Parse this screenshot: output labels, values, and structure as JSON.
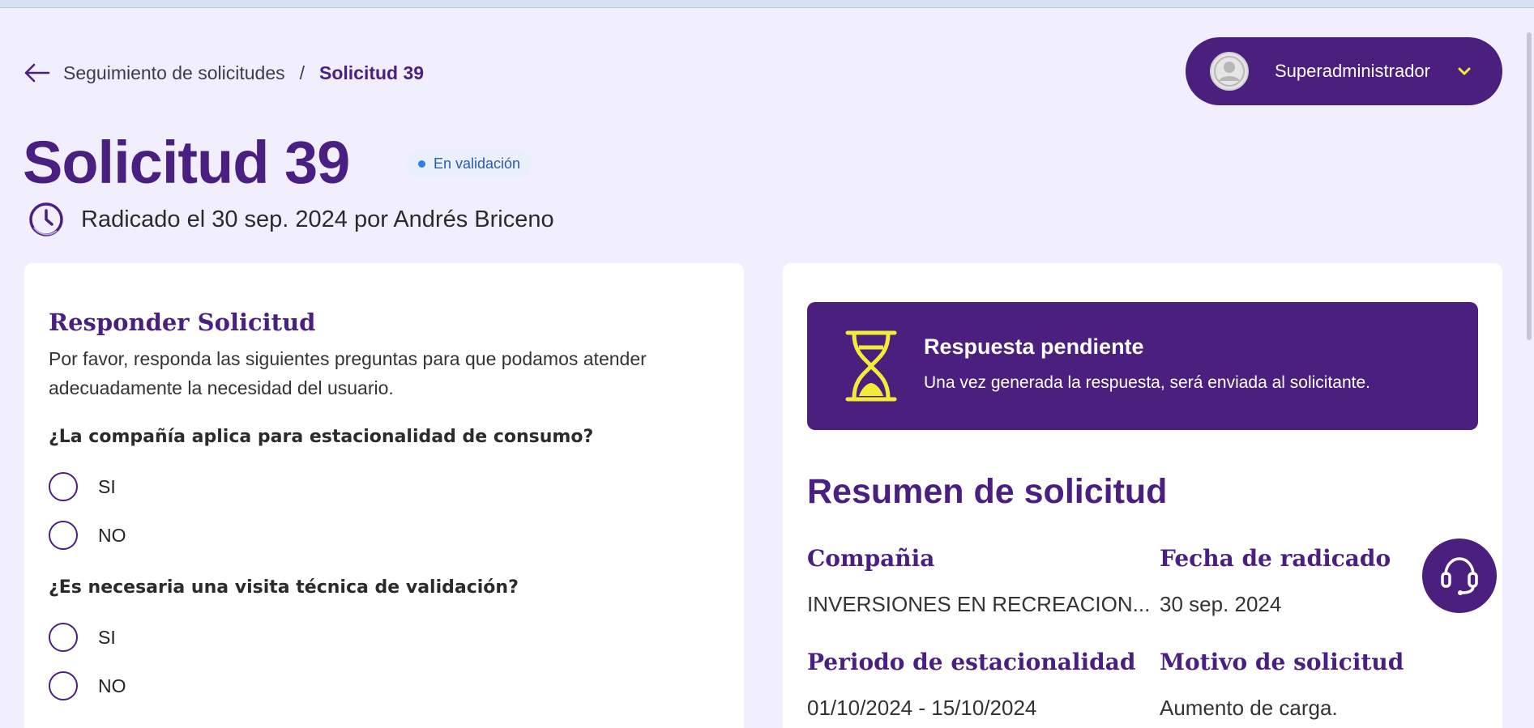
{
  "breadcrumb": {
    "parent": "Seguimiento de solicitudes",
    "separator": "/",
    "current": "Solicitud 39"
  },
  "user": {
    "name": "Superadministrador"
  },
  "header": {
    "title": "Solicitud 39",
    "status": "En validación",
    "filed": "Radicado el 30 sep. 2024 por Andrés Briceno"
  },
  "form": {
    "title": "Responder Solicitud",
    "description": "Por favor, responda las siguientes preguntas para que podamos atender adecuadamente la necesidad del usuario.",
    "questions": [
      {
        "text": "¿La compañía aplica para estacionalidad de consumo?",
        "options": [
          "SI",
          "NO"
        ]
      },
      {
        "text": "¿Es necesaria una visita técnica de validación?",
        "options": [
          "SI",
          "NO"
        ]
      }
    ]
  },
  "pending": {
    "title": "Respuesta pendiente",
    "description": "Una vez generada la respuesta, será enviada al solicitante."
  },
  "summary": {
    "title": "Resumen de solicitud",
    "fields": [
      {
        "label": "Compañia",
        "value": "INVERSIONES EN RECREACION..."
      },
      {
        "label": "Fecha de radicado",
        "value": "30 sep. 2024"
      },
      {
        "label": "Periodo de estacionalidad",
        "value": "01/10/2024 - 15/10/2024"
      },
      {
        "label": "Motivo de solicitud",
        "value": "Aumento de carga."
      }
    ]
  },
  "colors": {
    "brand": "#4a1f7d",
    "accent": "#f5ec3a",
    "background": "#f1effd",
    "status_dot": "#2f80ed"
  },
  "icons": [
    "back-arrow-icon",
    "chevron-down-icon",
    "user-avatar-icon",
    "clock-icon",
    "hourglass-icon",
    "headset-icon"
  ]
}
